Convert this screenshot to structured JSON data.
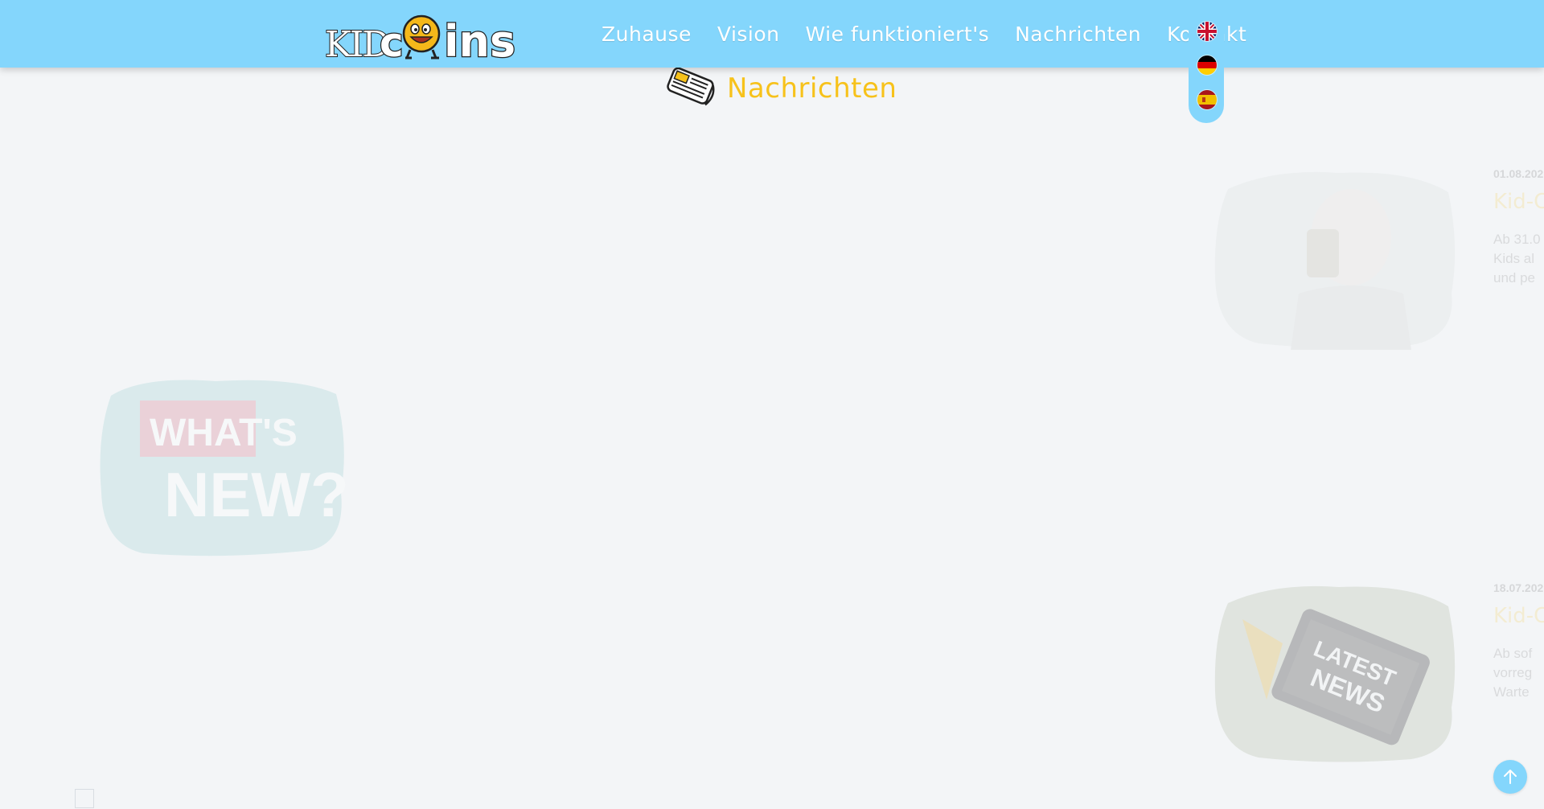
{
  "header": {
    "logo_alt": "KIDcoins",
    "nav": [
      {
        "label": "Zuhause"
      },
      {
        "label": "Vision"
      },
      {
        "label": "Wie funktioniert's"
      },
      {
        "label": "Nachrichten"
      },
      {
        "label": "Kontakt"
      }
    ],
    "languages": [
      {
        "code": "en",
        "icon": "uk-flag-icon"
      },
      {
        "code": "de",
        "icon": "germany-flag-icon"
      },
      {
        "code": "es",
        "icon": "spain-flag-icon"
      }
    ]
  },
  "section": {
    "title": "Nachrichten",
    "icon": "newspaper-icon"
  },
  "news": [
    {
      "date": "01.08.202",
      "title": "Kid-Co",
      "excerpt": "Ab 31.0\nKids al\nund pe"
    },
    {
      "date": "18.07.202",
      "title": "Kid-Co",
      "excerpt": "Ab sof\nvorreg\nWarte"
    }
  ],
  "images": {
    "whats_new": {
      "line1": "WHAT'S",
      "line2": "NEW?"
    },
    "latest_news": {
      "line1": "LATEST",
      "line2": "NEWS"
    }
  },
  "colors": {
    "header_bg": "#84d6fc",
    "accent_yellow": "#f7c21b",
    "page_bg": "#f3f5f7"
  },
  "back_to_top": {
    "icon": "arrow-up-icon"
  }
}
